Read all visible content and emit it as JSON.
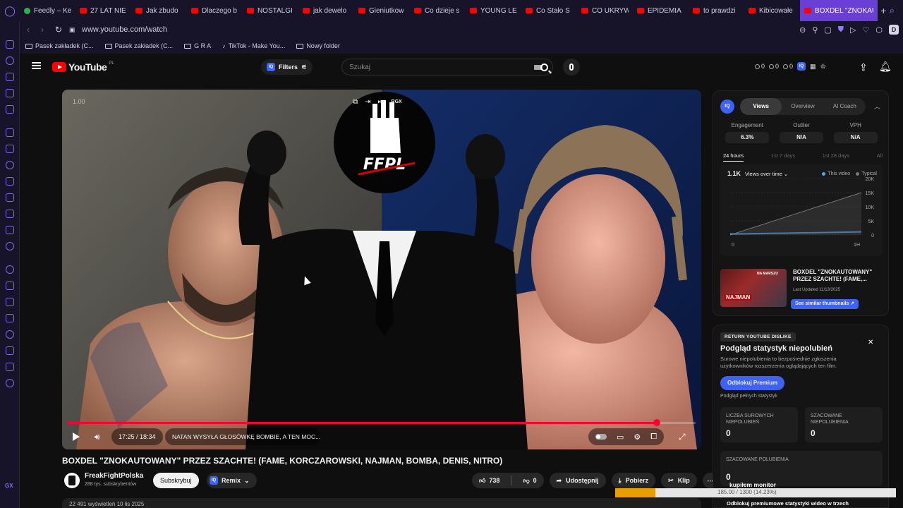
{
  "browser": {
    "tabs": [
      {
        "label": "Feedly – Ke",
        "favicon": "feedly",
        "active": false
      },
      {
        "label": "27 LAT NIE",
        "favicon": "youtube",
        "active": false
      },
      {
        "label": "Jak zbudo",
        "favicon": "youtube",
        "active": false
      },
      {
        "label": "Dlaczego b",
        "favicon": "youtube",
        "active": false
      },
      {
        "label": "NOSTALGI",
        "favicon": "youtube",
        "active": false
      },
      {
        "label": "jak dewelo",
        "favicon": "youtube",
        "active": false
      },
      {
        "label": "Gieniutkow",
        "favicon": "youtube",
        "active": false
      },
      {
        "label": "Co dzieje s",
        "favicon": "youtube",
        "active": false
      },
      {
        "label": "YOUNG LE",
        "favicon": "youtube",
        "active": false
      },
      {
        "label": "Co Stało S",
        "favicon": "youtube",
        "active": false
      },
      {
        "label": "CO UKRYW",
        "favicon": "youtube",
        "active": false
      },
      {
        "label": "EPIDEMIA",
        "favicon": "youtube",
        "active": false
      },
      {
        "label": "to prawdzi",
        "favicon": "youtube",
        "active": false
      },
      {
        "label": "Kibicowałe",
        "favicon": "youtube",
        "active": false
      },
      {
        "label": "BOXDEL \"ZNOKAUT",
        "favicon": "youtube",
        "active": true
      }
    ],
    "url": "www.youtube.com/watch",
    "profile_initial": "D",
    "bookmarks": [
      {
        "label": "Pasek zakładek (C...",
        "icon": "folder-icon"
      },
      {
        "label": "Pasek zakładek (C...",
        "icon": "folder-icon"
      },
      {
        "label": "G R A",
        "icon": "folder-icon"
      },
      {
        "label": "TikTok - Make You...",
        "icon": "tiktok-icon"
      },
      {
        "label": "Nowy folder",
        "icon": "folder-icon"
      }
    ],
    "sidebar_label": "GX"
  },
  "youtube": {
    "logo_text": "YouTube",
    "country_code": "PL",
    "filters_label": "Filters",
    "search_placeholder": "Szukaj",
    "header_stats": [
      "0",
      "0",
      "0"
    ]
  },
  "player": {
    "speed": "1.00",
    "overlay_logo": "FFPL",
    "top_label": "RGX",
    "time": "17:25 / 18:34",
    "progress": 0.938,
    "chapter": "NATAN WYSYŁA GŁOSÓWKĘ BOMBIE, A TEN MOC...",
    "chapter_arrow": "›"
  },
  "video": {
    "title": "BOXDEL \"ZNOKAUTOWANY\" PRZEZ SZACHTE! (FAME, KORCZAROWSKI, NAJMAN, BOMBA, DENIS, NITRO)",
    "channel": "FreakFightPolska",
    "subscribers": "288 tys. subskrybentów",
    "subscribe_label": "Subskrybuj",
    "remix_label": "Remix",
    "likes": "738",
    "dislikes": "0",
    "share_label": "Udostępnij",
    "download_label": "Pobierz",
    "clip_label": "Klip",
    "description_preview": "22 491 wyświetleń  10 lis 2025"
  },
  "iq_panel": {
    "logo": "IQ",
    "tabs": [
      "Views",
      "Overview",
      "AI Coach"
    ],
    "active_tab": 0,
    "metrics": [
      {
        "label": "Engagement",
        "value": "6.3%"
      },
      {
        "label": "Outlier",
        "value": "N/A"
      },
      {
        "label": "VPH",
        "value": "N/A"
      }
    ],
    "ranges": [
      "24 hours",
      "1st 7 days",
      "1st 28 days",
      "All"
    ],
    "active_range": 0,
    "views_count": "1.1K",
    "views_dropdown": "Views over time",
    "legend": [
      {
        "label": "This video",
        "color": "#4aa8ff"
      },
      {
        "label": "Typical",
        "color": "#777777"
      }
    ],
    "chart_data": {
      "type": "line",
      "x_ticks": [
        "0",
        "1H"
      ],
      "y_ticks": [
        "20K",
        "15K",
        "10K",
        "5K",
        "0"
      ],
      "ylim": [
        0,
        20000
      ],
      "series": [
        {
          "name": "This video",
          "x": [
            0,
            1
          ],
          "values": [
            300,
            1100
          ]
        },
        {
          "name": "Typical",
          "x": [
            0,
            1
          ],
          "values": [
            0,
            15000
          ]
        }
      ]
    },
    "thumbnail": {
      "title": "BOXDEL \"ZNOKAUTOWANY\" PRZEZ SZACHTE! (FAME,...",
      "updated": "Last Updated 11/13/2025",
      "caption": "NAJMAN",
      "caption_top": "NA MARSZU",
      "button": "See similar thumbnails"
    }
  },
  "ryd_panel": {
    "tag": "RETURN YOUTUBE DISLIKE",
    "title": "Podgląd statystyk niepolubień",
    "description": "Surowe niepolubienia to bezpośrednie zgłoszenia użytkowników rozszerzenia oglądających ten film.",
    "unlock_label": "Odblokuj Premium",
    "sub_label": "Podgląd pełnych statystyk",
    "stats": [
      {
        "label": "LICZBA SUROWYCH NIEPOLUBIEŃ",
        "value": "0"
      },
      {
        "label": "SZACOWANE NIEPOLUBIENIA",
        "value": "0"
      },
      {
        "label": "SZACOWANE POLUBIENIA",
        "value": "0"
      }
    ]
  },
  "overlay": {
    "label": "kupiłem monitor",
    "progress_text": "185.00 / 1300 (14.23%)",
    "progress": 0.1423,
    "bottom_line": "Odblokuj premiumowe statystyki wideo w trzech"
  }
}
